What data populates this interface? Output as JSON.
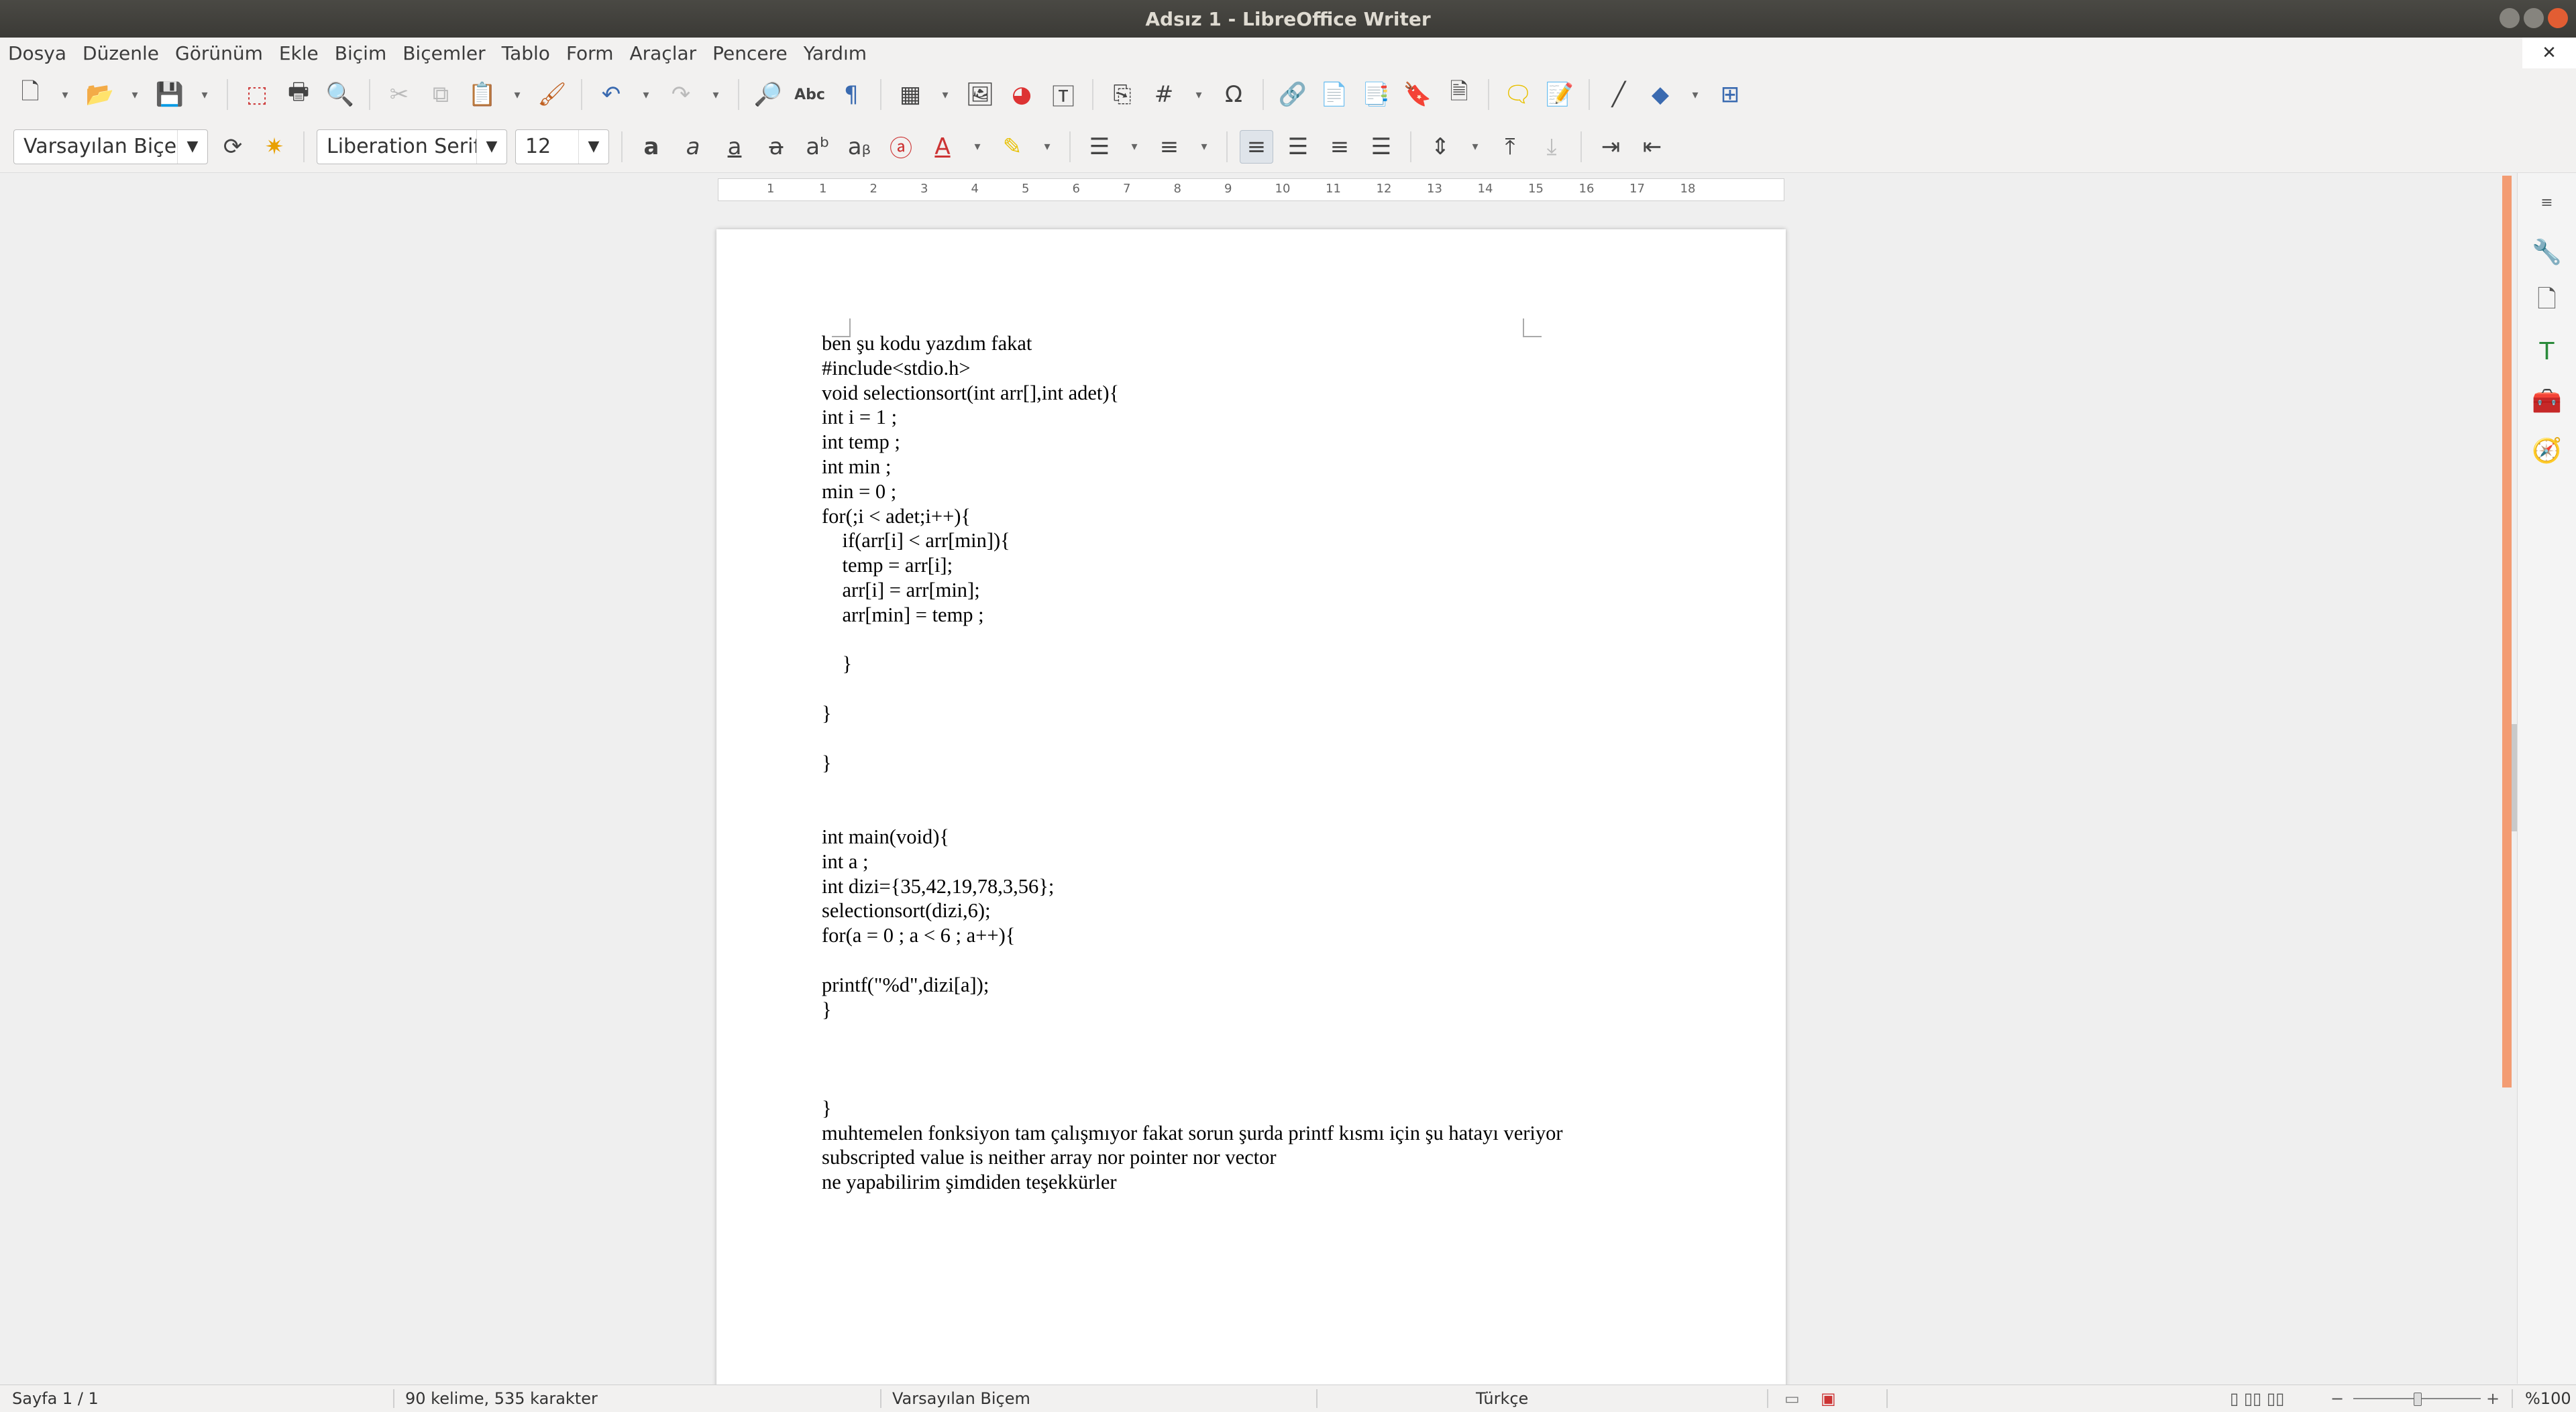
{
  "window": {
    "title": "Adsız 1 - LibreOffice Writer"
  },
  "menu": [
    "Dosya",
    "Düzenle",
    "Görünüm",
    "Ekle",
    "Biçim",
    "Biçemler",
    "Tablo",
    "Form",
    "Araçlar",
    "Pencere",
    "Yardım"
  ],
  "formatting": {
    "paragraph_style": "Varsayılan Biçe",
    "font_name": "Liberation Serif",
    "font_size": "12"
  },
  "ruler": {
    "marks": [
      "1",
      "1",
      "2",
      "3",
      "4",
      "5",
      "6",
      "7",
      "8",
      "9",
      "10",
      "11",
      "12",
      "13",
      "14",
      "15",
      "16",
      "17",
      "18"
    ]
  },
  "document": {
    "lines": [
      "ben şu kodu yazdım fakat",
      "#include<stdio.h>",
      "void selectionsort(int arr[],int adet){",
      "int i = 1 ;",
      "int temp ;",
      "int min ;",
      "min = 0 ;",
      "for(;i < adet;i++){",
      "    if(arr[i] < arr[min]){",
      "    temp = arr[i];",
      "    arr[i] = arr[min];",
      "    arr[min] = temp ;",
      "",
      "    }",
      "",
      "}",
      "",
      "}",
      "",
      "",
      "int main(void){",
      "int a ;",
      "int dizi={35,42,19,78,3,56};",
      "selectionsort(dizi,6);",
      "for(a = 0 ; a < 6 ; a++){",
      "",
      "printf(\"%d\",dizi[a]);",
      "}",
      "",
      "",
      "",
      "}",
      "muhtemelen fonksiyon tam çalışmıyor fakat sorun şurda printf kısmı için şu hatayı veriyor",
      "subscripted value is neither array nor pointer nor vector",
      "ne yapabilirim şimdiden teşekkürler"
    ]
  },
  "status": {
    "page": "Sayfa 1 / 1",
    "words": "90 kelime, 535 karakter",
    "page_style": "Varsayılan Biçem",
    "language": "Türkçe",
    "zoom": "%100"
  }
}
